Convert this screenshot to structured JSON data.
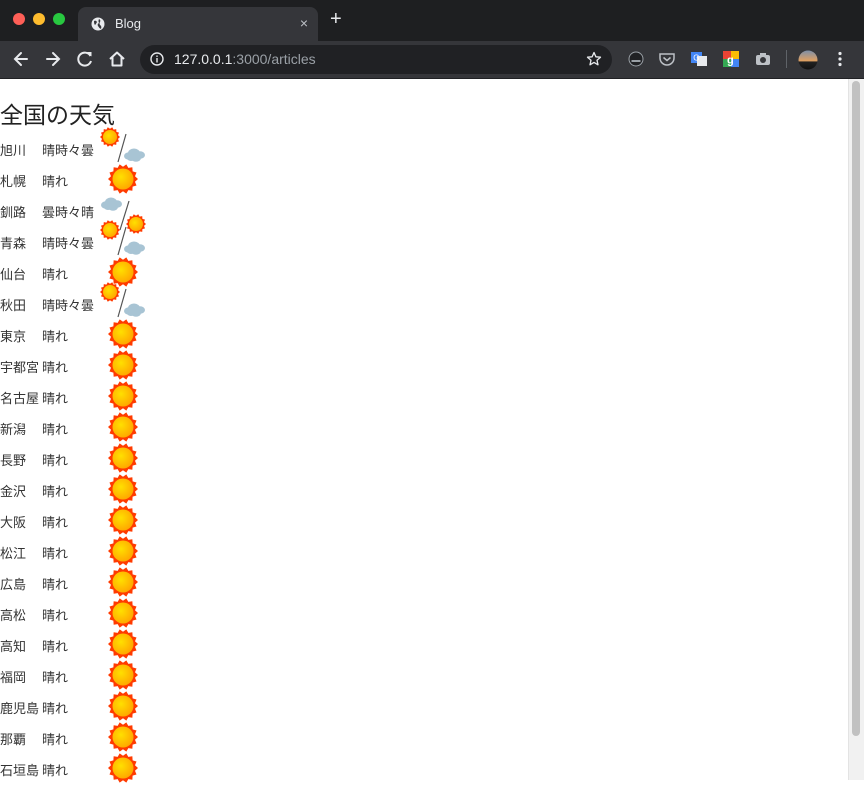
{
  "browser": {
    "tab_title": "Blog",
    "tab_close": "×",
    "new_tab": "+",
    "url_host": "127.0.0.1",
    "url_path": ":3000/articles",
    "icons": [
      "back-icon",
      "forward-icon",
      "reload-icon",
      "home-icon",
      "info-icon",
      "star-icon",
      "extension-icon",
      "pocket-icon",
      "translate-icon",
      "google-icon",
      "camera-icon",
      "profile-avatar",
      "menu-icon"
    ]
  },
  "page": {
    "heading": "全国の天気",
    "colors": {
      "sun_outer": "#ff3b00",
      "sun_inner": "#ffe000",
      "cloud": "#a8c4d4"
    },
    "rows": [
      {
        "city": "旭川",
        "weather": "晴時々曇",
        "icon": "sun-cloud"
      },
      {
        "city": "札幌",
        "weather": "晴れ",
        "icon": "sun"
      },
      {
        "city": "釧路",
        "weather": "曇時々晴",
        "icon": "cloud-sun"
      },
      {
        "city": "青森",
        "weather": "晴時々曇",
        "icon": "sun-cloud"
      },
      {
        "city": "仙台",
        "weather": "晴れ",
        "icon": "sun"
      },
      {
        "city": "秋田",
        "weather": "晴時々曇",
        "icon": "sun-cloud"
      },
      {
        "city": "東京",
        "weather": "晴れ",
        "icon": "sun"
      },
      {
        "city": "宇都宮",
        "weather": "晴れ",
        "icon": "sun"
      },
      {
        "city": "名古屋",
        "weather": "晴れ",
        "icon": "sun"
      },
      {
        "city": "新潟",
        "weather": "晴れ",
        "icon": "sun"
      },
      {
        "city": "長野",
        "weather": "晴れ",
        "icon": "sun"
      },
      {
        "city": "金沢",
        "weather": "晴れ",
        "icon": "sun"
      },
      {
        "city": "大阪",
        "weather": "晴れ",
        "icon": "sun"
      },
      {
        "city": "松江",
        "weather": "晴れ",
        "icon": "sun"
      },
      {
        "city": "広島",
        "weather": "晴れ",
        "icon": "sun"
      },
      {
        "city": "高松",
        "weather": "晴れ",
        "icon": "sun"
      },
      {
        "city": "高知",
        "weather": "晴れ",
        "icon": "sun"
      },
      {
        "city": "福岡",
        "weather": "晴れ",
        "icon": "sun"
      },
      {
        "city": "鹿児島",
        "weather": "晴れ",
        "icon": "sun"
      },
      {
        "city": "那覇",
        "weather": "晴れ",
        "icon": "sun"
      },
      {
        "city": "石垣島",
        "weather": "晴れ",
        "icon": "sun"
      }
    ]
  }
}
